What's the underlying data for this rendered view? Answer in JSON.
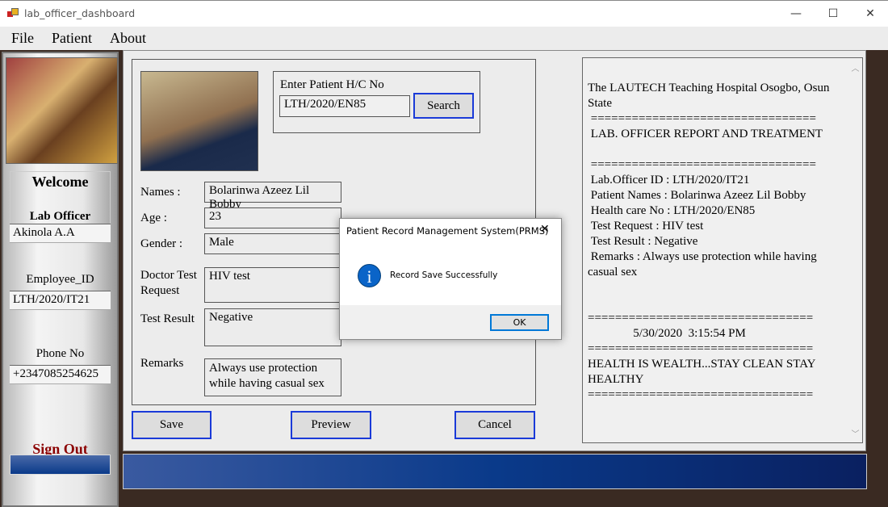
{
  "window": {
    "title": "lab_officer_dashboard",
    "minimize": "—",
    "maximize": "☐",
    "close": "✕"
  },
  "menu": [
    "File",
    "Patient",
    "About"
  ],
  "sidebar": {
    "welcome": "Welcome",
    "role_label": "Lab Officer",
    "name": "Akinola A.A",
    "employee_id_label": "Employee_ID",
    "employee_id": "LTH/2020/IT21",
    "phone_label": "Phone No",
    "phone": "+2347085254625",
    "sign_out": "Sign Out"
  },
  "search": {
    "label": "Enter Patient H/C No",
    "value": "LTH/2020/EN85",
    "button": "Search"
  },
  "form": {
    "names_label": "Names :",
    "names": "Bolarinwa Azeez Lil Bobby",
    "age_label": "Age :",
    "age": "23",
    "gender_label": "Gender :",
    "gender": "Male",
    "test_request_label": "Doctor Test Request",
    "test_request": "HIV test",
    "test_result_label": "Test Result",
    "test_result": "Negative",
    "remarks_label": "Remarks",
    "remarks": "Always use protection while having casual sex"
  },
  "buttons": {
    "save": "Save",
    "preview": "Preview",
    "cancel": "Cancel"
  },
  "report": {
    "text": "The LAUTECH Teaching Hospital Osogbo, Osun State\n =================================\n LAB. OFFICER REPORT AND TREATMENT\n\n =================================\n Lab.Officer ID : LTH/2020/IT21\n Patient Names : Bolarinwa Azeez Lil Bobby\n Health care No : LTH/2020/EN85\n Test Request : HIV test\n Test Result : Negative\n Remarks : Always use protection while having casual sex\n\n\n=================================\n               5/30/2020  3:15:54 PM\n=================================\nHEALTH IS WEALTH...STAY CLEAN STAY HEALTHY\n================================="
  },
  "dialog": {
    "title": "Patient Record Management System(PRMS)",
    "message": "Record Save Successfully",
    "ok": "OK",
    "close": "✕",
    "icon": "info-icon",
    "accent": "#0a64c8"
  }
}
